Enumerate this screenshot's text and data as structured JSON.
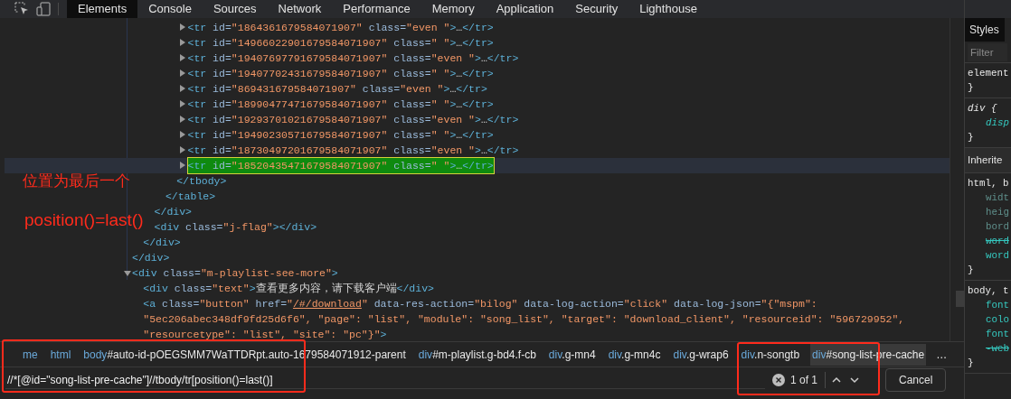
{
  "tabs": [
    {
      "label": "Elements",
      "selected": true
    },
    {
      "label": "Console",
      "selected": false
    },
    {
      "label": "Sources",
      "selected": false
    },
    {
      "label": "Network",
      "selected": false
    },
    {
      "label": "Performance",
      "selected": false
    },
    {
      "label": "Memory",
      "selected": false
    },
    {
      "label": "Application",
      "selected": false
    },
    {
      "label": "Security",
      "selected": false
    },
    {
      "label": "Lighthouse",
      "selected": false
    }
  ],
  "dom_tree": [
    {
      "close": "</div>",
      "children": [
        {
          "close": "</div>",
          "children": [
            {
              "close": "</div>",
              "children": [
                {
                  "close": "</table>",
                  "children": [
                    {
                      "close": "</tbody>",
                      "children": [
                        {
                          "lines": [
                            "<tr id=\"1864361679584071907\" class=\"even \">…</tr>"
                          ],
                          "expanded": false,
                          "selected": false,
                          "match": false
                        },
                        {
                          "lines": [
                            "<tr id=\"14966022901679584071907\" class=\" \">…</tr>"
                          ],
                          "expanded": false,
                          "selected": false,
                          "match": false
                        },
                        {
                          "lines": [
                            "<tr id=\"19407697791679584071907\" class=\"even \">…</tr>"
                          ],
                          "expanded": false,
                          "selected": false,
                          "match": false
                        },
                        {
                          "lines": [
                            "<tr id=\"19407702431679584071907\" class=\" \">…</tr>"
                          ],
                          "expanded": false,
                          "selected": false,
                          "match": false
                        },
                        {
                          "lines": [
                            "<tr id=\"869431679584071907\" class=\"even \">…</tr>"
                          ],
                          "expanded": false,
                          "selected": false,
                          "match": false
                        },
                        {
                          "lines": [
                            "<tr id=\"18990477471679584071907\" class=\" \">…</tr>"
                          ],
                          "expanded": false,
                          "selected": false,
                          "match": false
                        },
                        {
                          "lines": [
                            "<tr id=\"19293701021679584071907\" class=\"even \">…</tr>"
                          ],
                          "expanded": false,
                          "selected": false,
                          "match": false
                        },
                        {
                          "lines": [
                            "<tr id=\"19490230571679584071907\" class=\" \">…</tr>"
                          ],
                          "expanded": false,
                          "selected": false,
                          "match": false
                        },
                        {
                          "lines": [
                            "<tr id=\"18730497201679584071907\" class=\"even \">…</tr>"
                          ],
                          "expanded": false,
                          "selected": false,
                          "match": false
                        },
                        {
                          "lines": [
                            "<tr id=\"18520435471679584071907\" class=\" \">…</tr>"
                          ],
                          "expanded": false,
                          "selected": true,
                          "match": true
                        }
                      ]
                    }
                  ]
                }
              ]
            },
            {
              "lines": [
                "<div class=\"j-flag\"></div>"
              ]
            }
          ]
        }
      ]
    },
    {
      "lines": [
        "<div class=\"m-playlist-see-more\">"
      ],
      "expanded": true,
      "children": [
        {
          "lines": [
            "<div class=\"text\">查看更多内容，请下载客户端</div>"
          ]
        },
        {
          "lines": [
            "<a class=\"button\" href=\"/#/download\" data-res-action=\"bilog\" data-log-action=\"click\" data-log-json=\"{\"mspm\":",
            "\"5ec206abec348df9fd25d6f6\", \"page\": \"list\", \"module\": \"song_list\", \"target\": \"download_client\", \"resourceid\": \"596729952\",",
            "\"resourcetype\": \"list\", \"site\": \"pc\"}\">"
          ]
        }
      ]
    }
  ],
  "breadcrumbs": [
    {
      "tag": "me",
      "selected": false
    },
    {
      "tag": "html",
      "selected": false
    },
    {
      "tag": "body",
      "rest": "#auto-id-pOEGSMM7WaTTDRpt.auto-1679584071912-parent",
      "selected": false
    },
    {
      "tag": "div",
      "rest": "#m-playlist.g-bd4.f-cb",
      "selected": false
    },
    {
      "tag": "div",
      "rest": ".g-mn4",
      "selected": false
    },
    {
      "tag": "div",
      "rest": ".g-mn4c",
      "selected": false
    },
    {
      "tag": "div",
      "rest": ".g-wrap6",
      "selected": false
    },
    {
      "tag": "div",
      "rest": ".n-songtb",
      "selected": false
    },
    {
      "tag": "div",
      "rest": "#song-list-pre-cache",
      "selected": true
    }
  ],
  "breadcrumb_more": "…",
  "search": {
    "value": "//*[@id=\"song-list-pre-cache\"]//tbody/tr[position()=last()]",
    "match_count": "1 of 1",
    "cancel": "Cancel"
  },
  "styles_panel": {
    "tab": "Styles",
    "filter_placeholder": "Filter",
    "sections": [
      {
        "kind": "rule",
        "lines": [
          {
            "kind": "selector",
            "text": "element"
          },
          {
            "kind": "brace",
            "text": "}"
          }
        ]
      },
      {
        "kind": "rule",
        "lines": [
          {
            "kind": "ua-selector",
            "text": "div {"
          },
          {
            "kind": "ua-prop",
            "text": "disp"
          },
          {
            "kind": "brace",
            "text": "}"
          }
        ]
      },
      {
        "kind": "header",
        "text": "Inherite"
      },
      {
        "kind": "rule",
        "lines": [
          {
            "kind": "selector",
            "text": "html, b"
          },
          {
            "kind": "dim",
            "text": "widt"
          },
          {
            "kind": "dim",
            "text": "heig"
          },
          {
            "kind": "dim",
            "text": "bord"
          },
          {
            "kind": "struck",
            "text": "word"
          },
          {
            "kind": "prop",
            "text": "word"
          },
          {
            "kind": "brace",
            "text": "}"
          }
        ]
      },
      {
        "kind": "rule",
        "lines": [
          {
            "kind": "selector",
            "text": "body, t"
          },
          {
            "kind": "prop",
            "text": "font"
          },
          {
            "kind": "prop",
            "text": "colo"
          },
          {
            "kind": "prop",
            "text": "font"
          },
          {
            "kind": "struck",
            "text": "-web"
          },
          {
            "kind": "brace",
            "text": "}"
          }
        ]
      }
    ]
  },
  "annotations": [
    {
      "text": "位置为最后一个"
    },
    {
      "text": "position()=last()"
    }
  ]
}
